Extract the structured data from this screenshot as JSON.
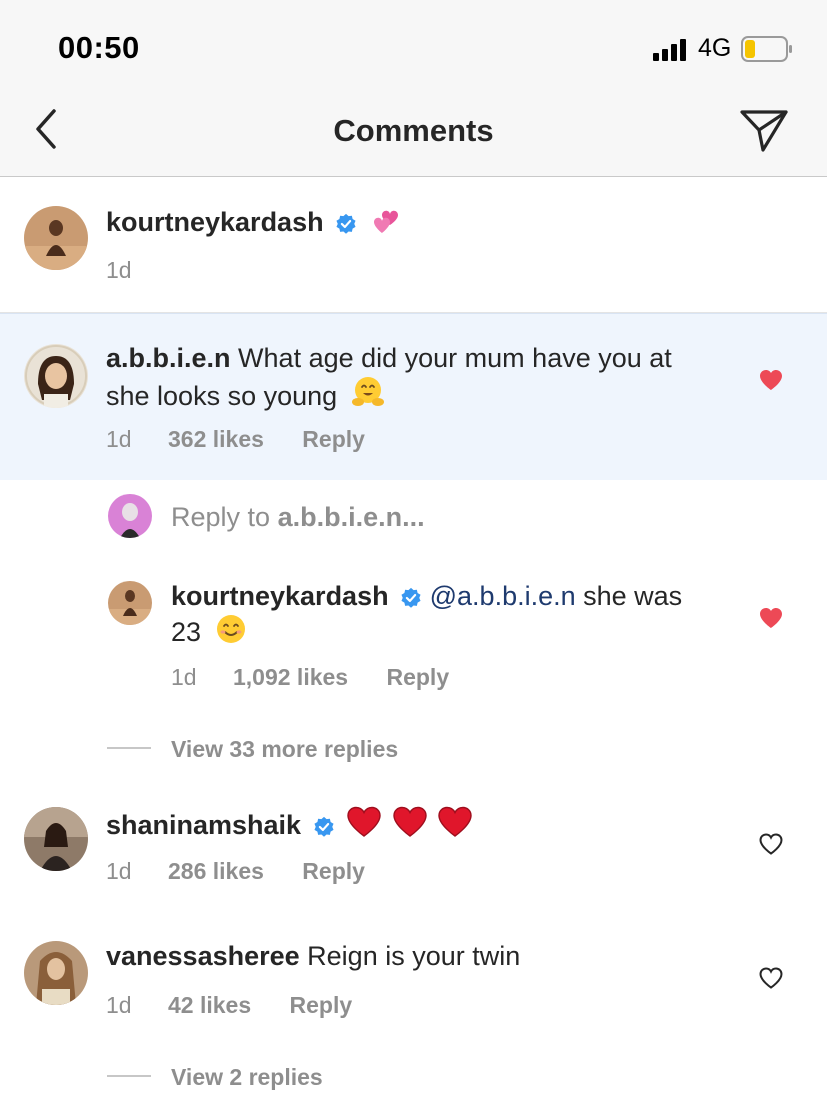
{
  "status": {
    "time": "00:50",
    "network": "4G",
    "battery_color": "#f5c400"
  },
  "header": {
    "title": "Comments"
  },
  "caption": {
    "username": "kourtneykardash",
    "time": "1d"
  },
  "comments": [
    {
      "username": "a.b.b.i.e.n",
      "text_line1": "What age did your mum have you at",
      "text_line2": "she looks so young",
      "time": "1d",
      "likes": "362 likes",
      "reply": "Reply",
      "liked": true
    },
    {
      "username": "shaninamshaik",
      "time": "1d",
      "likes": "286 likes",
      "reply": "Reply",
      "liked": false
    },
    {
      "username": "vanessasheree",
      "text": "Reign is your twin",
      "time": "1d",
      "likes": "42 likes",
      "reply": "Reply",
      "liked": false
    }
  ],
  "reply_prompt": {
    "prefix": "Reply to ",
    "target": "a.b.b.i.e.n..."
  },
  "reply": {
    "username": "kourtneykardash",
    "mention": "@a.b.b.i.e.n",
    "text_line1": " she was",
    "text_line2": "23",
    "time": "1d",
    "likes": "1,092 likes",
    "reply": "Reply",
    "liked": true
  },
  "view_more_1": "View 33 more replies",
  "view_more_2": "View 2 replies",
  "colors": {
    "like_red": "#ed4956",
    "verified_blue": "#3897f0",
    "meta_gray": "#8e8e8e"
  }
}
